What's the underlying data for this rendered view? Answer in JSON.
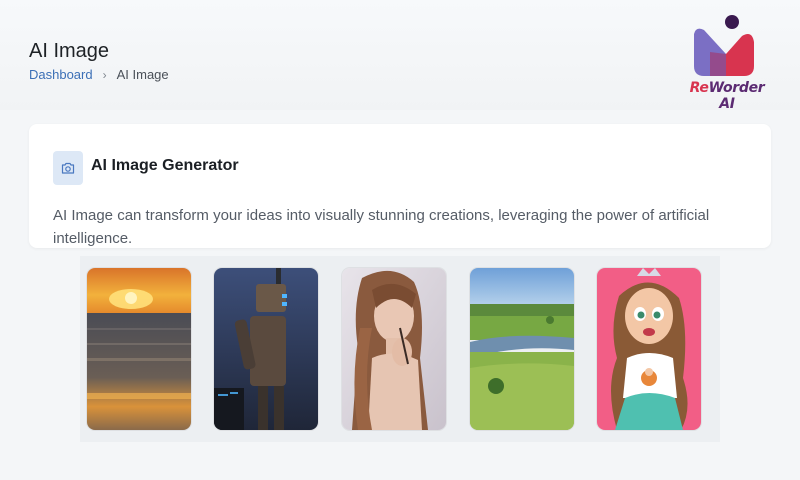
{
  "header": {
    "title": "AI Image",
    "breadcrumb": {
      "link": "Dashboard",
      "separator": "›",
      "current": "AI Image"
    }
  },
  "brand": {
    "logo_text_prefix": "Re",
    "logo_text_rest": "Worder AI",
    "colors": {
      "primary": "#d8344f",
      "secondary": "#5b2a72",
      "accent": "#7b6fc4"
    }
  },
  "card": {
    "icon": "camera-icon",
    "title": "AI Image Generator",
    "description": "AI Image can transform your ideas into visually stunning creations, leveraging the power of artificial intelligence."
  },
  "gallery": {
    "images": [
      {
        "name": "sunset-ocean-image"
      },
      {
        "name": "robot-image"
      },
      {
        "name": "woman-portrait-image"
      },
      {
        "name": "green-landscape-image"
      },
      {
        "name": "cartoon-princess-image"
      }
    ]
  }
}
